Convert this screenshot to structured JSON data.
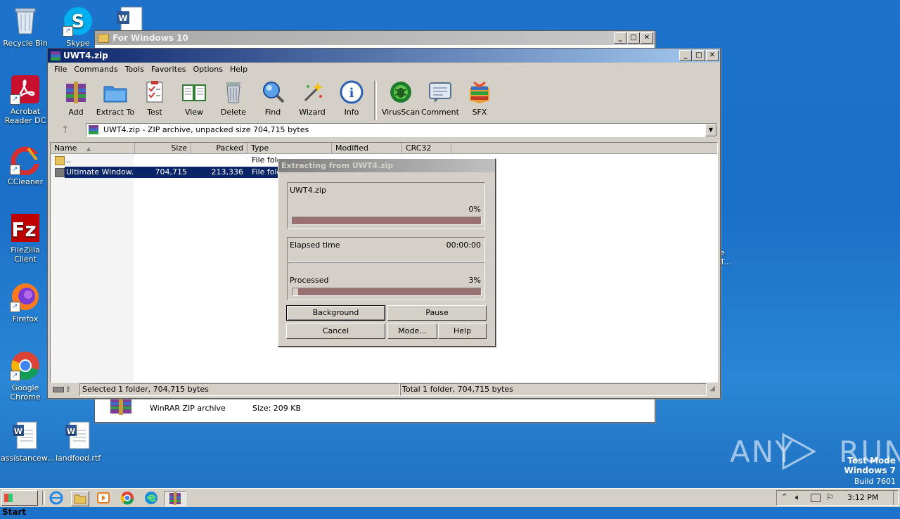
{
  "desktop": {
    "icons": [
      {
        "label": "Recycle Bin"
      },
      {
        "label": "Skype"
      },
      {
        "label": "Acrobat Reader DC"
      },
      {
        "label": "CCleaner"
      },
      {
        "label": "FileZilla Client"
      },
      {
        "label": "Firefox"
      },
      {
        "label": "Google Chrome"
      },
      {
        "label": "assistancew..."
      },
      {
        "label": "landfood.rtf"
      }
    ],
    "partial_label_1": "e",
    "partial_label_2": "T..."
  },
  "background_window": {
    "title": "For Windows 10",
    "file_type": "WinRAR ZIP archive",
    "file_size": "Size: 209 KB"
  },
  "winrar": {
    "title": "UWT4.zip",
    "menu": [
      "File",
      "Commands",
      "Tools",
      "Favorites",
      "Options",
      "Help"
    ],
    "toolbar": [
      "Add",
      "Extract To",
      "Test",
      "View",
      "Delete",
      "Find",
      "Wizard",
      "Info",
      "VirusScan",
      "Comment",
      "SFX"
    ],
    "address": "UWT4.zip - ZIP archive, unpacked size 704,715 bytes",
    "columns": [
      "Name",
      "Size",
      "Packed",
      "Type",
      "Modified",
      "CRC32"
    ],
    "rows": [
      {
        "name": "..",
        "size": "",
        "packed": "",
        "type": "File fold"
      },
      {
        "name": "Ultimate Window...",
        "size": "704,715",
        "packed": "213,336",
        "type": "File fold"
      }
    ],
    "status_left": "Selected 1 folder, 704,715 bytes",
    "status_right": "Total 1 folder, 704,715 bytes"
  },
  "extract_dialog": {
    "title": "Extracting from UWT4.zip",
    "archive": "UWT4.zip",
    "file_percent": "0%",
    "file_progress": 0,
    "elapsed_label": "Elapsed time",
    "elapsed_value": "00:00:00",
    "processed_label": "Processed",
    "processed_percent": "3%",
    "processed_progress": 0.03,
    "buttons": {
      "background": "Background",
      "pause": "Pause",
      "cancel": "Cancel",
      "mode": "Mode...",
      "help": "Help"
    }
  },
  "taskbar": {
    "start": "Start",
    "clock": "3:12 PM"
  },
  "watermark": {
    "text": "ANY RUN",
    "test_mode": "Test Mode",
    "os": "Windows 7",
    "build": "Build 7601"
  }
}
